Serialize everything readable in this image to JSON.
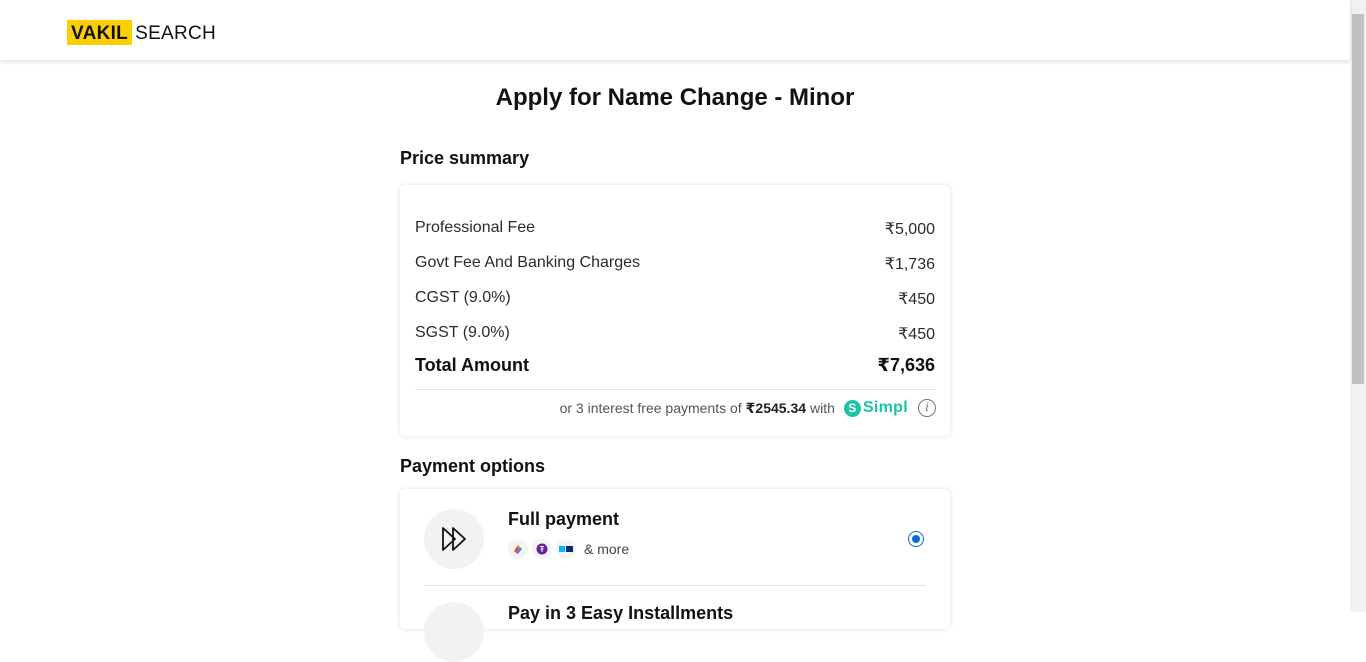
{
  "header": {
    "logo_part1": "VAKIL",
    "logo_part2": "SEARCH"
  },
  "page": {
    "title": "Apply for Name Change - Minor"
  },
  "price_summary": {
    "heading": "Price summary",
    "rows": [
      {
        "label": "Professional Fee",
        "value": "₹5,000"
      },
      {
        "label": "Govt Fee And Banking Charges",
        "value": "₹1,736"
      },
      {
        "label": "CGST (9.0%)",
        "value": "₹450"
      },
      {
        "label": "SGST (9.0%)",
        "value": "₹450"
      }
    ],
    "total_label": "Total Amount",
    "total_value": "₹7,636",
    "emi_prefix": "or 3 interest free payments of",
    "emi_amount": "₹2545.34",
    "emi_suffix": "with",
    "emi_provider": "Simpl",
    "info_glyph": "i"
  },
  "payment_options": {
    "heading": "Payment options",
    "options": [
      {
        "title": "Full payment",
        "more_text": "& more",
        "selected": true
      },
      {
        "title": "Pay in 3 Easy Installments",
        "selected": false
      }
    ],
    "method_icons": [
      "gpay-icon",
      "phonepe-icon",
      "paytm-icon"
    ]
  },
  "colors": {
    "brand_yellow": "#fcd000",
    "simpl_teal": "#1ec1a4",
    "radio_blue": "#0b6bd4"
  }
}
